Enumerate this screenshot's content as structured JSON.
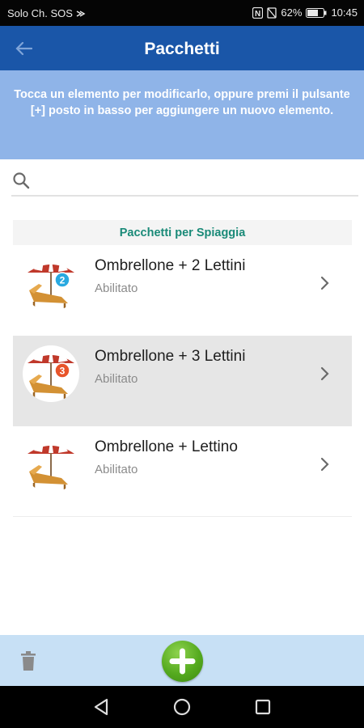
{
  "status_bar": {
    "carrier": "Solo Ch. SOS",
    "battery": "62%",
    "time": "10:45"
  },
  "app_bar": {
    "title": "Pacchetti"
  },
  "info": {
    "text": "Tocca un elemento per modificarlo, oppure premi il pulsante [+] posto in basso per aggiungere un nuovo elemento."
  },
  "search": {
    "placeholder": "",
    "value": ""
  },
  "section": {
    "title": "Pacchetti per Spiaggia"
  },
  "packages": [
    {
      "title": "Ombrellone + 2 Lettini",
      "status": "Abilitato",
      "badge": "2",
      "badge_color": "#29a9e0",
      "selected": false
    },
    {
      "title": "Ombrellone + 3 Lettini",
      "status": "Abilitato",
      "badge": "3",
      "badge_color": "#e8542a",
      "selected": true
    },
    {
      "title": "Ombrellone + Lettino",
      "status": "Abilitato",
      "badge": "",
      "badge_color": "",
      "selected": false
    }
  ],
  "colors": {
    "app_bar": "#1a56a8",
    "info_bg": "#8fb4e8",
    "section_text": "#1a8a78",
    "bottom_bar": "#c7e0f5",
    "add_button": "#55aa1f"
  },
  "icons": {
    "back": "arrow-left-icon",
    "search": "search-icon",
    "chevron": "chevron-right-icon",
    "delete": "trash-icon",
    "add": "plus-icon"
  }
}
